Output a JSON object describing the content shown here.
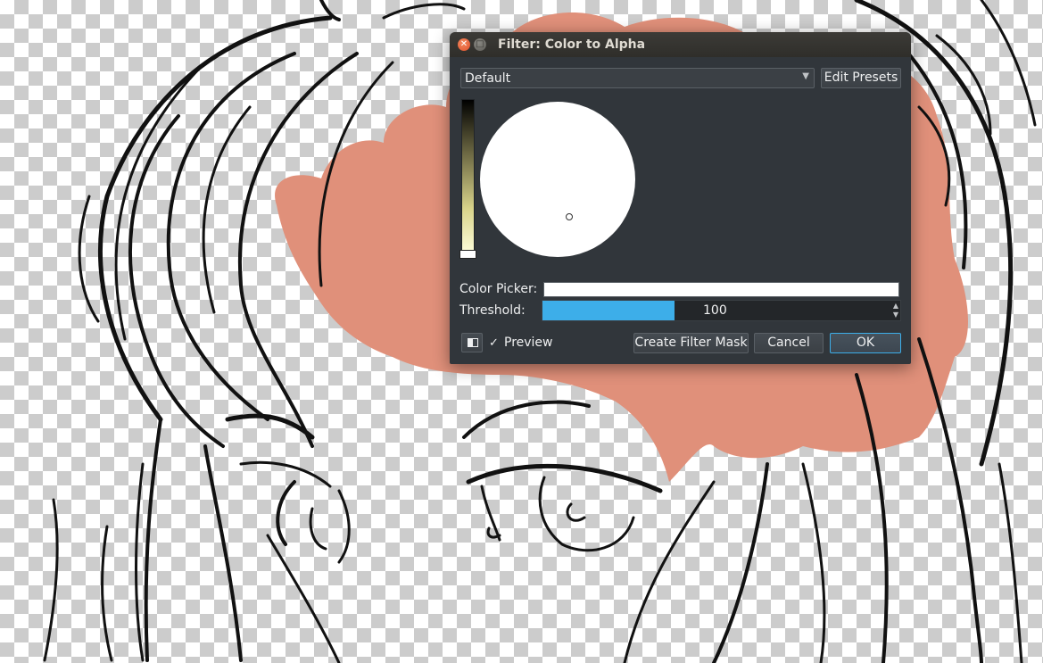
{
  "dialog": {
    "title": "Filter: Color to Alpha",
    "window_buttons": [
      "close-icon",
      "maximize-icon"
    ],
    "preset": {
      "selected": "Default",
      "edit_presets_label": "Edit Presets"
    },
    "color_selector": {
      "selected_color": "#ffffff"
    },
    "color_picker": {
      "label": "Color Picker:",
      "value": "#ffffff"
    },
    "threshold": {
      "label": "Threshold:",
      "value": "100",
      "fill_fraction": 0.37
    },
    "preview": {
      "checked": true,
      "check_glyph": "✓",
      "label": "Preview"
    },
    "buttons": {
      "create_filter_mask": "Create Filter Mask",
      "cancel": "Cancel",
      "ok": "OK"
    }
  },
  "colors": {
    "dialog_bg": "#31363b",
    "accent": "#3daee9",
    "paint_blob": "#e0907a",
    "line_art": "#111111"
  }
}
